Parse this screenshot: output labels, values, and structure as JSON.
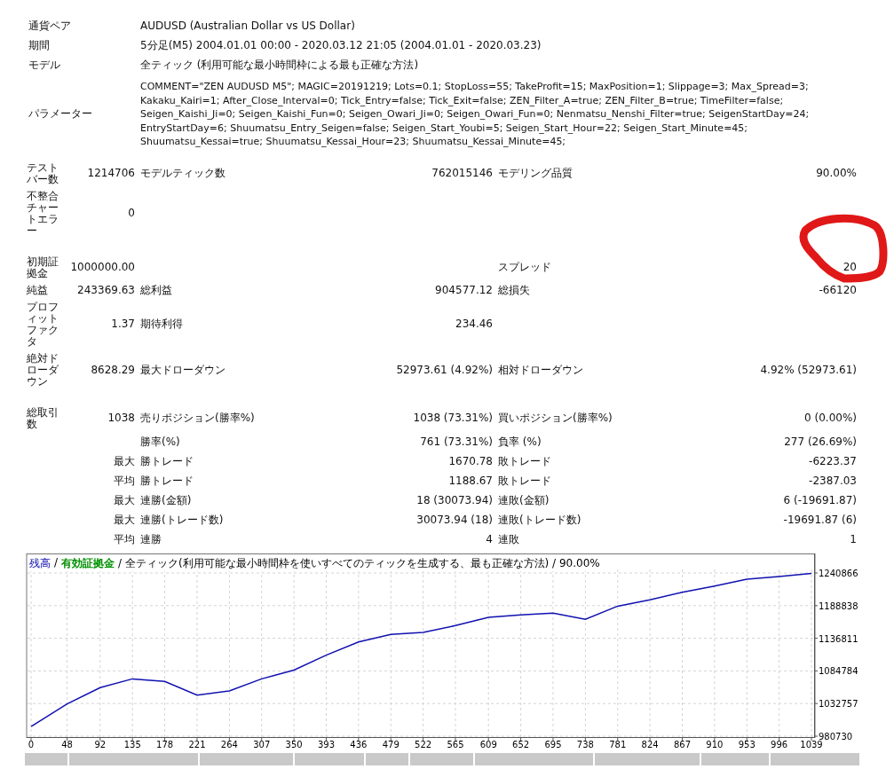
{
  "header": [
    {
      "label": "通貨ペア",
      "value": "AUDUSD (Australian Dollar vs US Dollar)"
    },
    {
      "label": "期間",
      "value": "5分足(M5) 2004.01.01 00:00 - 2020.03.12 21:05 (2004.01.01 - 2020.03.23)"
    },
    {
      "label": "モデル",
      "value": "全ティック (利用可能な最小時間枠による最も正確な方法)"
    }
  ],
  "parameters": {
    "label": "パラメーター",
    "lines": [
      "COMMENT=\"ZEN AUDUSD M5\"; MAGIC=20191219; Lots=0.1; StopLoss=55; TakeProfit=15; MaxPosition=1; Slippage=3; Max_Spread=3;",
      "Kakaku_Kairi=1; After_Close_Interval=0; Tick_Entry=false; Tick_Exit=false; ZEN_Filter_A=true; ZEN_Filter_B=true; TimeFilter=false;",
      "Seigen_Kaishi_Ji=0; Seigen_Kaishi_Fun=0; Seigen_Owari_Ji=0; Seigen_Owari_Fun=0; Nenmatsu_Nenshi_Filter=true; SeigenStartDay=24;",
      "EntryStartDay=6; Shuumatsu_Entry_Seigen=false; Seigen_Start_Youbi=5; Seigen_Start_Hour=22; Seigen_Start_Minute=45;",
      "Shuumatsu_Kessai=true; Shuumatsu_Kessai_Hour=23; Shuumatsu_Kessai_Minute=45;"
    ]
  },
  "stats": [
    {
      "l1": "テストバー数",
      "v1": "1214706",
      "l2": "モデルティック数",
      "v2": "762015146",
      "l3": "モデリング品質",
      "v3": "90.00%"
    },
    {
      "l1": "不整合チャートエラー",
      "v1": "0"
    },
    {
      "l1": "初期証拠金",
      "v1": "1000000.00",
      "l3": "スプレッド",
      "v3": "20"
    },
    {
      "l1": "純益",
      "v1": "243369.63",
      "l2": "総利益",
      "v2": "904577.12",
      "l3": "総損失",
      "v3": "-66120"
    },
    {
      "l1": "プロフィットファクタ",
      "v1": "1.37",
      "l2": "期待利得",
      "v2": "234.46"
    },
    {
      "l1": "絶対ドローダウン",
      "v1": "8628.29",
      "l2": "最大ドローダウン",
      "v2": "52973.61 (4.92%)",
      "l3": "相対ドローダウン",
      "v3": "4.92% (52973.61)"
    },
    {
      "l1": "総取引数",
      "v1": "1038",
      "l2": "売りポジション(勝率%)",
      "v2": "1038 (73.31%)",
      "l3": "買いポジション(勝率%)",
      "v3": "0 (0.00%)"
    },
    {
      "l2": "勝率(%)",
      "v2": "761 (73.31%)",
      "l3": "負率 (%)",
      "v3": "277 (26.69%)"
    },
    {
      "v1": "最大",
      "l2": "勝トレード",
      "v2": "1670.78",
      "l3": "敗トレード",
      "v3": "-6223.37"
    },
    {
      "v1": "平均",
      "l2": "勝トレード",
      "v2": "1188.67",
      "l3": "敗トレード",
      "v3": "-2387.03"
    },
    {
      "v1": "最大",
      "l2": "連勝(金額)",
      "v2": "18 (30073.94)",
      "l3": "連敗(金額)",
      "v3": "6 (-19691.87)"
    },
    {
      "v1": "最大",
      "l2": "連勝(トレード数)",
      "v2": "30073.94 (18)",
      "l3": "連敗(トレード数)",
      "v3": "-19691.87 (6)"
    },
    {
      "v1": "平均",
      "l2": "連勝",
      "v2": "4",
      "l3": "連敗",
      "v3": "1"
    }
  ],
  "chart": {
    "legend": [
      {
        "text": "/"
      },
      {
        "text": "有効証拠金",
        "color": "#009000"
      },
      {
        "text": "/ 全ティック(利用可能な最小時間枠を使いすべてのティックを生成する、最も正確な方法) / 90.00%"
      }
    ],
    "chart_data": {
      "type": "line",
      "grid": true,
      "x": [
        0,
        48,
        92,
        135,
        178,
        221,
        264,
        307,
        350,
        393,
        436,
        479,
        522,
        565,
        609,
        652,
        695,
        738,
        781,
        824,
        867,
        910,
        953,
        996,
        1039
      ],
      "series": [
        {
          "name": "残高",
          "color": "#1010b0",
          "values": [
            996000,
            1032000,
            1058000,
            1072000,
            1068000,
            1046000,
            1053000,
            1072000,
            1086000,
            1110000,
            1131000,
            1143000,
            1146000,
            1157000,
            1170000,
            1174000,
            1177000,
            1167000,
            1188000,
            1198000,
            1210000,
            1220000,
            1231000,
            1235000,
            1240000
          ]
        }
      ],
      "xticks": [
        0,
        48,
        92,
        135,
        178,
        221,
        264,
        307,
        350,
        393,
        436,
        479,
        522,
        565,
        609,
        652,
        695,
        738,
        781,
        824,
        867,
        910,
        953,
        996,
        1039
      ],
      "yticks": [
        980730,
        1032757,
        1084784,
        1136811,
        1188838,
        1240866
      ],
      "xlim": [
        0,
        1039
      ],
      "ylim": [
        980730,
        1240866
      ]
    }
  }
}
